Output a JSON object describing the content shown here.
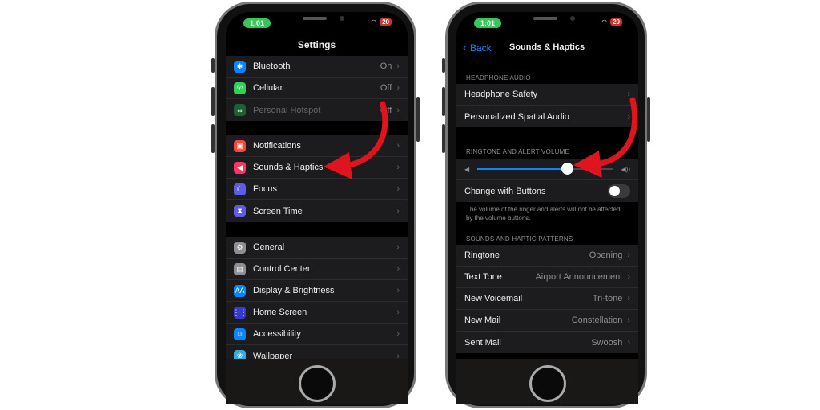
{
  "status": {
    "time": "1:01",
    "battery": "20"
  },
  "left": {
    "title": "Settings",
    "groups": [
      [
        {
          "label": "Bluetooth",
          "value": "On",
          "icon": "bluetooth-icon",
          "color": "#0a84ff",
          "glyph": "✱"
        },
        {
          "label": "Cellular",
          "value": "Off",
          "icon": "cellular-icon",
          "color": "#30d158",
          "glyph": "⁽ᵞ⁾"
        },
        {
          "label": "Personal Hotspot",
          "value": "Off",
          "icon": "hotspot-icon",
          "color": "#1f5f33",
          "glyph": "∞",
          "dim": true
        }
      ],
      [
        {
          "label": "Notifications",
          "icon": "notifications-icon",
          "color": "#ff453a",
          "glyph": "▣"
        },
        {
          "label": "Sounds & Haptics",
          "icon": "speaker-icon",
          "color": "#ff375f",
          "glyph": "◀"
        },
        {
          "label": "Focus",
          "icon": "moon-icon",
          "color": "#5e5ce6",
          "glyph": "☾"
        },
        {
          "label": "Screen Time",
          "icon": "hourglass-icon",
          "color": "#5e5ce6",
          "glyph": "⧗"
        }
      ],
      [
        {
          "label": "General",
          "icon": "gear-icon",
          "color": "#8e8e93",
          "glyph": "⚙"
        },
        {
          "label": "Control Center",
          "icon": "toggles-icon",
          "color": "#8e8e93",
          "glyph": "▤"
        },
        {
          "label": "Display & Brightness",
          "icon": "display-icon",
          "color": "#0a84ff",
          "glyph": "AA"
        },
        {
          "label": "Home Screen",
          "icon": "grid-icon",
          "color": "#3a3ad0",
          "glyph": "⋮⋮"
        },
        {
          "label": "Accessibility",
          "icon": "accessibility-icon",
          "color": "#0a84ff",
          "glyph": "☺"
        },
        {
          "label": "Wallpaper",
          "icon": "wallpaper-icon",
          "color": "#35aadc",
          "glyph": "❀"
        }
      ]
    ]
  },
  "right": {
    "back": "Back",
    "title": "Sounds & Haptics",
    "headphone_header": "HEADPHONE AUDIO",
    "headphone_rows": [
      "Headphone Safety",
      "Personalized Spatial Audio"
    ],
    "volume_header": "RINGTONE AND ALERT VOLUME",
    "volume_percent": 66,
    "change_with_buttons": "Change with Buttons",
    "change_with_buttons_on": false,
    "footnote": "The volume of the ringer and alerts will not be affected by the volume buttons.",
    "patterns_header": "SOUNDS AND HAPTIC PATTERNS",
    "patterns": [
      {
        "label": "Ringtone",
        "value": "Opening"
      },
      {
        "label": "Text Tone",
        "value": "Airport Announcement"
      },
      {
        "label": "New Voicemail",
        "value": "Tri-tone"
      },
      {
        "label": "New Mail",
        "value": "Constellation"
      },
      {
        "label": "Sent Mail",
        "value": "Swoosh"
      }
    ]
  },
  "colors": {
    "accent": "#0a84ff",
    "arrow": "#e0141e",
    "slider": "#0a84ff"
  }
}
